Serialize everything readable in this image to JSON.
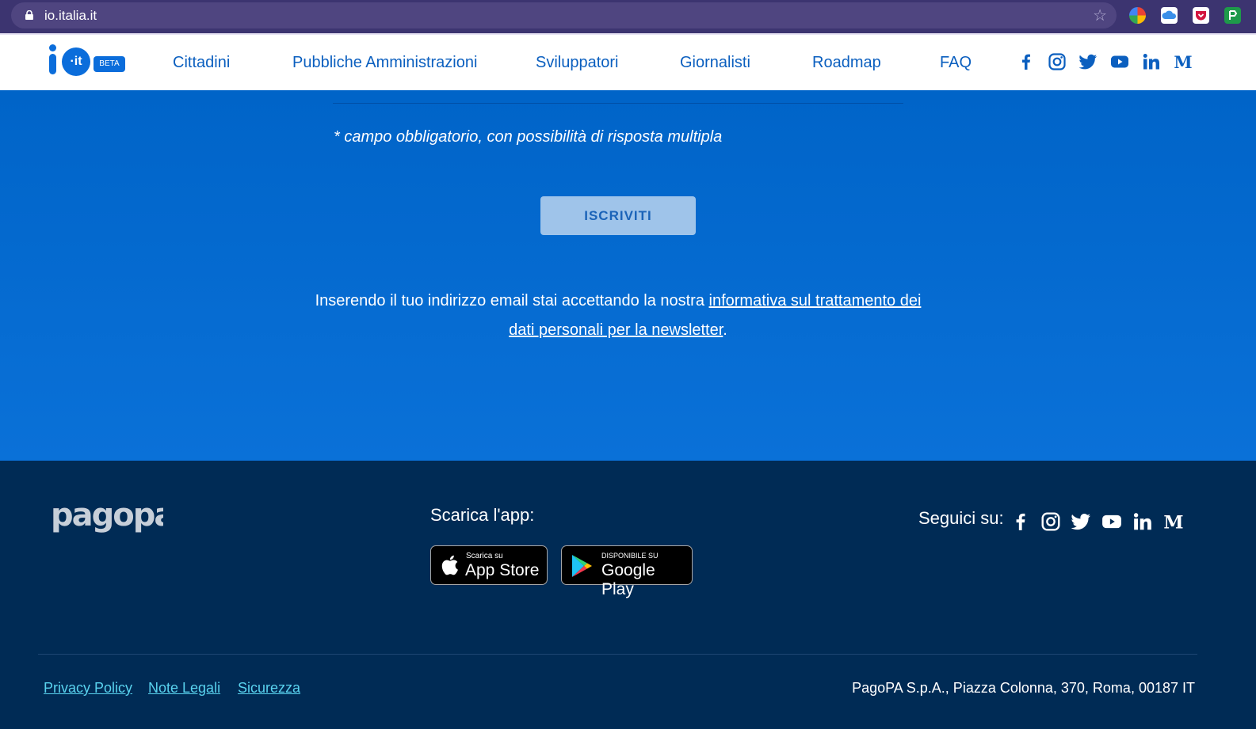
{
  "browser": {
    "url": "io.italia.it"
  },
  "header": {
    "logo_text": "io",
    "logo_circle": "·it",
    "beta_label": "BETA",
    "nav": [
      {
        "label": "Cittadini"
      },
      {
        "label": "Pubbliche Amministrazioni"
      },
      {
        "label": "Sviluppatori"
      },
      {
        "label": "Giornalisti"
      },
      {
        "label": "Roadmap"
      },
      {
        "label": "FAQ"
      }
    ],
    "social_icons": [
      "facebook-icon",
      "instagram-icon",
      "twitter-icon",
      "youtube-icon",
      "linkedin-icon",
      "medium-icon"
    ]
  },
  "newsletter": {
    "required_note": "* campo obbligatorio, con possibilità di risposta multipla",
    "submit_label": "ISCRIVITI",
    "consent_prefix": "Inserendo il tuo indirizzo email stai accettando la nostra ",
    "consent_link": "informativa sul trattamento dei dati personali per la newsletter",
    "consent_suffix": "."
  },
  "footer": {
    "brand": "pagopa",
    "download_title": "Scarica l'app:",
    "app_store": {
      "small": "Scarica su",
      "big": "App Store"
    },
    "google_play": {
      "small": "DISPONIBILE SU",
      "big": "Google Play"
    },
    "follow_label": "Seguici su:",
    "links": [
      {
        "label": "Privacy Policy"
      },
      {
        "label": "Note Legali"
      },
      {
        "label": "Sicurezza"
      }
    ],
    "company": "PagoPA S.p.A., Piazza Colonna, 370, Roma, 00187 IT"
  },
  "colors": {
    "brand_blue": "#0b6ddb",
    "nav_text": "#0b5fbf",
    "footer_bg": "#002b55",
    "footer_link": "#59d2ee"
  }
}
